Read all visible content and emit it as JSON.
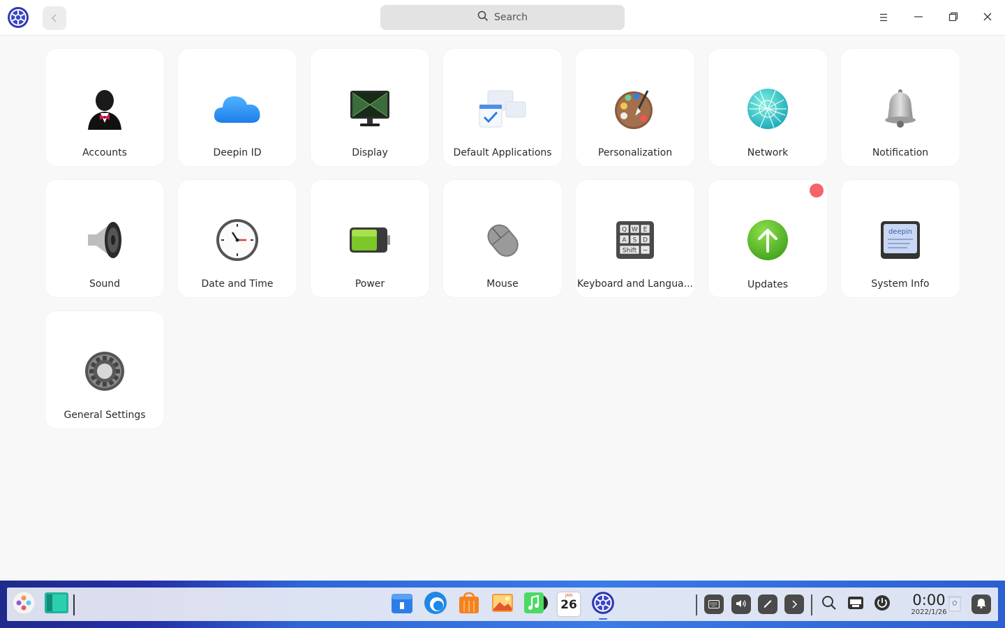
{
  "titlebar": {
    "search_placeholder": "Search",
    "icons": [
      "control-center-logo",
      "back-arrow",
      "search",
      "menu",
      "minimize",
      "maximize",
      "close"
    ]
  },
  "modules": [
    {
      "label": "Accounts",
      "icon": "accounts-icon"
    },
    {
      "label": "Deepin ID",
      "icon": "cloud-icon"
    },
    {
      "label": "Display",
      "icon": "monitor-icon"
    },
    {
      "label": "Default Applications",
      "icon": "default-apps-icon"
    },
    {
      "label": "Personalization",
      "icon": "palette-icon"
    },
    {
      "label": "Network",
      "icon": "globe-network-icon"
    },
    {
      "label": "Notification",
      "icon": "bell-icon"
    },
    {
      "label": "Sound",
      "icon": "speaker-icon"
    },
    {
      "label": "Date and Time",
      "icon": "clock-icon"
    },
    {
      "label": "Power",
      "icon": "battery-icon"
    },
    {
      "label": "Mouse",
      "icon": "mouse-icon"
    },
    {
      "label": "Keyboard and Langua...",
      "icon": "keyboard-icon"
    },
    {
      "label": "Updates",
      "icon": "update-arrow-icon",
      "has_badge": true
    },
    {
      "label": "System Info",
      "icon": "system-info-icon"
    },
    {
      "label": "General Settings",
      "icon": "gear-icon"
    }
  ],
  "dock": {
    "apps": [
      "launcher-icon",
      "terminal-icon",
      "file-manager-icon",
      "browser-icon",
      "app-store-icon",
      "image-viewer-icon",
      "music-icon",
      "calendar-icon",
      "control-center-icon"
    ],
    "calendar_day": "26",
    "calendar_month": "JAN",
    "tray": [
      "onscreen-keyboard-icon",
      "volume-icon",
      "pen-icon",
      "expand-arrow-icon",
      "search-icon",
      "keyboard-layout-icon",
      "power-icon",
      "trash-icon",
      "notification-icon"
    ],
    "clock_time": "0:00",
    "clock_date": "2022/1/26"
  },
  "colors": {
    "badge": "#f5646b",
    "dock_gradient_start": "#1e2a8c",
    "dock_gradient_end": "#2c5fd0"
  }
}
